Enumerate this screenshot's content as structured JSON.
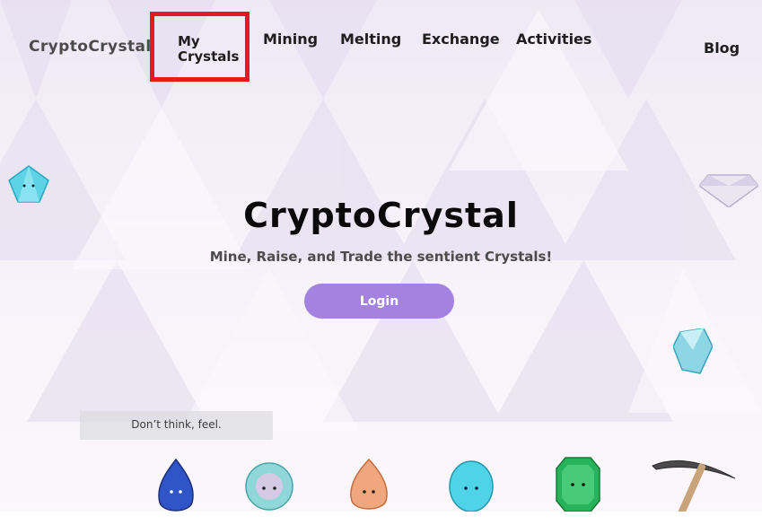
{
  "brand": "CryptoCrystal",
  "nav": {
    "my_crystals": "My Crystals",
    "mining": "Mining",
    "melting": "Melting",
    "exchange": "Exchange",
    "activities": "Activities",
    "blog": "Blog"
  },
  "hero": {
    "title": "CryptoCrystal",
    "subtitle": "Mine, Raise, and Trade the sentient Crystals!",
    "login_label": "Login"
  },
  "quote": "Don’t think, feel.",
  "colors": {
    "accent": "#a382e0",
    "highlight_box": "#e41b1b",
    "background": "#f3eef8"
  },
  "decorations": [
    "cyan-crystal-icon",
    "diamond-crystal-icon",
    "aqua-crystal-icon",
    "sapphire-crystal-character",
    "opal-crystal-character",
    "amber-crystal-character",
    "aquamarine-crystal-character",
    "emerald-crystal-character",
    "pickaxe-icon"
  ]
}
